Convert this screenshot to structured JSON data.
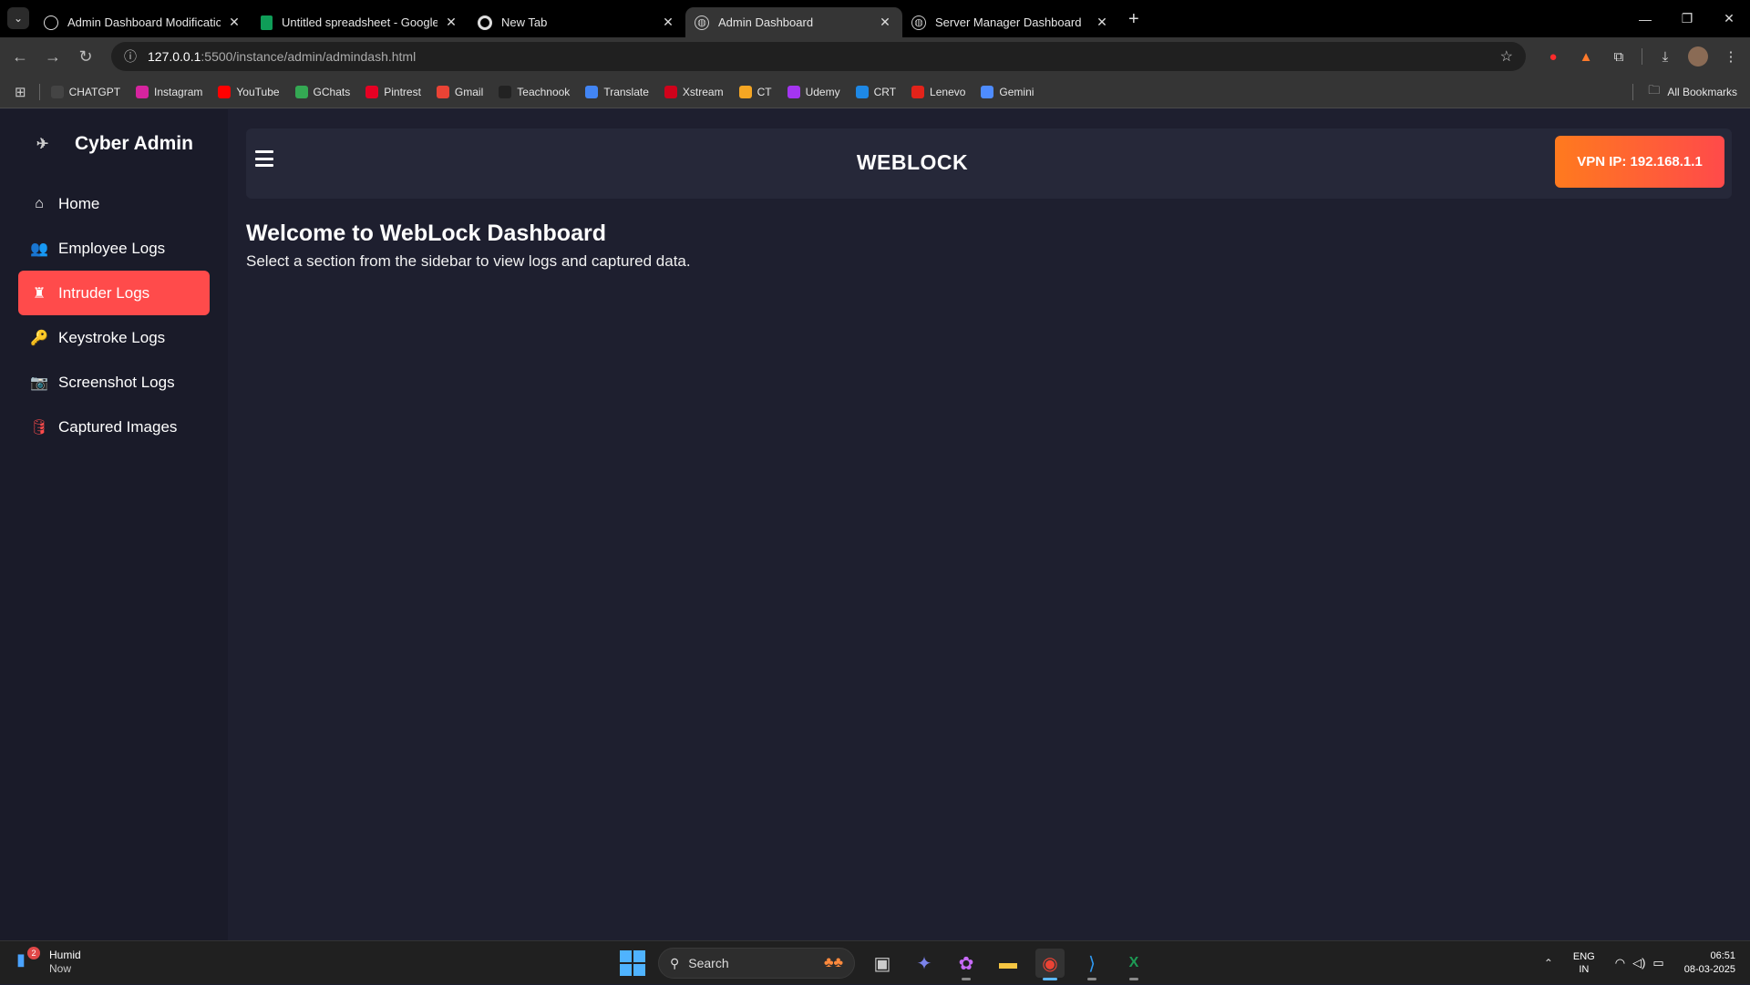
{
  "browser": {
    "tabs": [
      {
        "title": "Admin Dashboard Modification",
        "icon": "openai-icon",
        "active": false
      },
      {
        "title": "Untitled spreadsheet - Google Sheets",
        "icon": "sheets-icon",
        "active": false
      },
      {
        "title": "New Tab",
        "icon": "chrome-icon",
        "active": false
      },
      {
        "title": "Admin Dashboard",
        "icon": "globe-icon",
        "active": true
      },
      {
        "title": "Server Manager Dashboard",
        "icon": "globe-icon",
        "active": false
      }
    ],
    "url_host": "127.0.0.1",
    "url_path": ":5500/instance/admin/admindash.html",
    "bookmarks": [
      {
        "label": "CHATGPT",
        "color": "#444444"
      },
      {
        "label": "Instagram",
        "color": "#d6249f"
      },
      {
        "label": "YouTube",
        "color": "#ff0000"
      },
      {
        "label": "GChats",
        "color": "#34a853"
      },
      {
        "label": "Pintrest",
        "color": "#e60023"
      },
      {
        "label": "Gmail",
        "color": "#ea4335"
      },
      {
        "label": "Teachnook",
        "color": "#222222"
      },
      {
        "label": "Translate",
        "color": "#4285f4"
      },
      {
        "label": "Xstream",
        "color": "#d0021b"
      },
      {
        "label": "CT",
        "color": "#f5a623"
      },
      {
        "label": "Udemy",
        "color": "#a435f0"
      },
      {
        "label": "CRT",
        "color": "#1e88e5"
      },
      {
        "label": "Lenevo",
        "color": "#e2231a"
      },
      {
        "label": "Gemini",
        "color": "#4e8cff"
      }
    ],
    "all_bookmarks": "All Bookmarks"
  },
  "sidebar": {
    "brand": "Cyber Admin",
    "items": [
      {
        "label": "Home",
        "icon": "home-icon",
        "glyph": "⌂",
        "color": "#ffffff",
        "active": false
      },
      {
        "label": "Employee Logs",
        "icon": "users-icon",
        "glyph": "👥",
        "color": "#ffffff",
        "active": false
      },
      {
        "label": "Intruder Logs",
        "icon": "intruder-icon",
        "glyph": "♜",
        "color": "#ffffff",
        "active": true
      },
      {
        "label": "Keystroke Logs",
        "icon": "key-icon",
        "glyph": "🔑",
        "color": "#ffffff",
        "active": false
      },
      {
        "label": "Screenshot Logs",
        "icon": "camera-icon",
        "glyph": "📷",
        "color": "#f5c518",
        "active": false
      },
      {
        "label": "Captured Images",
        "icon": "database-icon",
        "glyph": "🛢",
        "color": "#ff4b4b",
        "active": false
      }
    ]
  },
  "header": {
    "title": "WEBLOCK",
    "vpn_label": "VPN IP: 192.168.1.1"
  },
  "main": {
    "heading": "Welcome to WebLock Dashboard",
    "subtext": "Select a section from the sidebar to view logs and captured data."
  },
  "taskbar": {
    "weather_title": "Humid",
    "weather_sub": "Now",
    "weather_badge": "2",
    "search_placeholder": "Search",
    "lang_top": "ENG",
    "lang_bottom": "IN",
    "time": "06:51",
    "date": "08-03-2025"
  }
}
